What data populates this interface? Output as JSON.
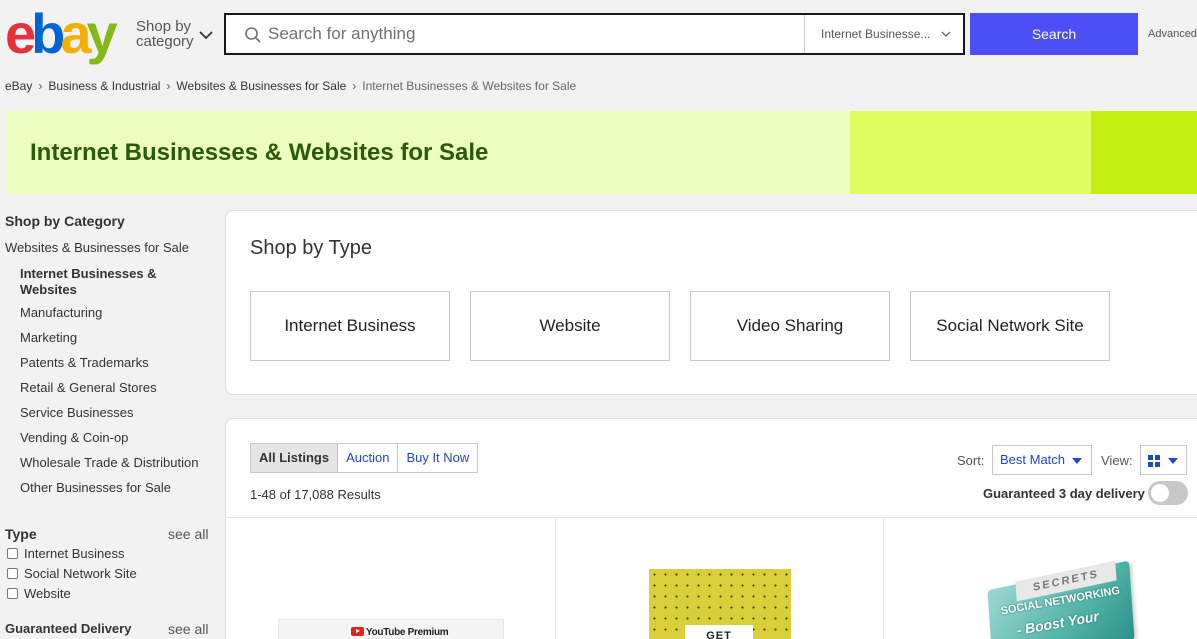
{
  "header": {
    "logo": {
      "letters": [
        "e",
        "b",
        "a",
        "y"
      ],
      "colors": [
        "#e53238",
        "#0064d2",
        "#f5af02",
        "#86b817"
      ]
    },
    "shop_by_category": [
      "Shop by",
      "category"
    ],
    "search": {
      "placeholder": "Search for anything",
      "category": "Internet Businesse...",
      "button": "Search",
      "advanced": "Advanced"
    }
  },
  "breadcrumb": [
    "eBay",
    "Business & Industrial",
    "Websites & Businesses for Sale",
    "Internet Businesses & Websites for Sale"
  ],
  "banner": {
    "title": "Internet Businesses & Websites for Sale",
    "colors": {
      "main": "#edfdc0",
      "block1": "#e0fd5f",
      "block2": "#c5ef10",
      "title": "#2b5a0b"
    }
  },
  "sidebar": {
    "shop_by_category": {
      "heading": "Shop by Category",
      "parent": "Websites & Businesses for Sale",
      "items": [
        "Internet Businesses & Websites",
        "Manufacturing",
        "Marketing",
        "Patents & Trademarks",
        "Retail & General Stores",
        "Service Businesses",
        "Vending & Coin-op",
        "Wholesale Trade & Distribution",
        "Other Businesses for Sale"
      ],
      "active_index": 0
    },
    "type": {
      "heading": "Type",
      "see_all": "see all",
      "options": [
        "Internet Business",
        "Social Network Site",
        "Website"
      ]
    },
    "guaranteed_delivery": {
      "heading": "Guaranteed Delivery",
      "see_all": "see all"
    }
  },
  "shop_by_type": {
    "title": "Shop by Type",
    "cards": [
      "Internet Business",
      "Website",
      "Video Sharing",
      "Social Network Site"
    ]
  },
  "listings": {
    "tabs": [
      "All Listings",
      "Auction",
      "Buy It Now"
    ],
    "active_tab": 0,
    "results": "1-48 of 17,088 Results",
    "sort_label": "Sort:",
    "sort_value": "Best Match",
    "view_label": "View:",
    "guaranteed_label": "Guaranteed 3 day delivery",
    "guaranteed_on": false,
    "items": [
      {
        "thumb_text": "YouTube Premium"
      },
      {
        "thumb_text": "GET"
      },
      {
        "thumb_text_top": "SECRETS",
        "thumb_text_1": "SOCIAL NETWORKING",
        "thumb_text_2": "- Boost Your"
      }
    ]
  },
  "colors": {
    "accent": "#4b4ff5",
    "link": "#2447c4"
  }
}
